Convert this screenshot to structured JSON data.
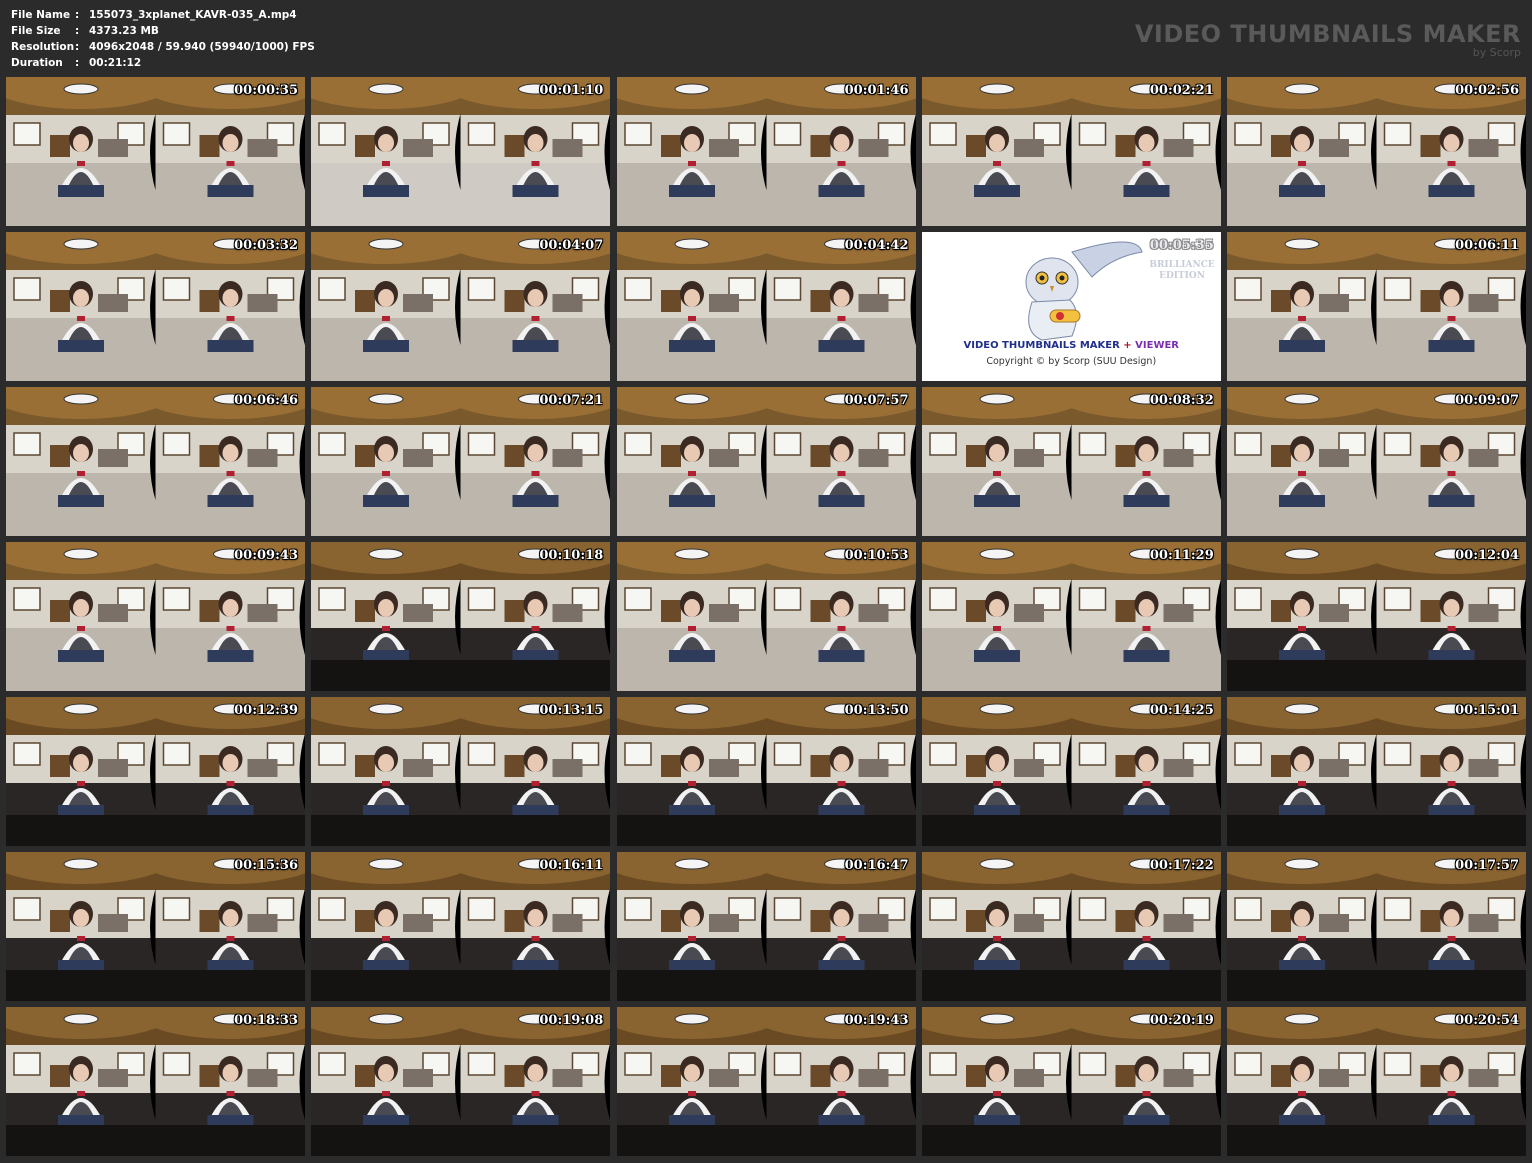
{
  "info": {
    "rows": [
      {
        "key": "File Name",
        "sep": ":",
        "value": "155073_3xplanet_KAVR-035_A.mp4"
      },
      {
        "key": "File Size",
        "sep": ":",
        "value": "4373.23 MB"
      },
      {
        "key": "Resolution",
        "sep": ":",
        "value": "4096x2048 / 59.940 (59940/1000) FPS"
      },
      {
        "key": "Duration",
        "sep": ":",
        "value": "00:21:12"
      }
    ]
  },
  "brand": {
    "title": "VIDEO THUMBNAILS MAKER",
    "subtitle": "by Scorp"
  },
  "logo_tile": {
    "line1_part1": "VIDEO THUMBNAILS MAKER",
    "line1_plus": " + ",
    "line1_part2": "VIEWER",
    "line2": "Copyright © by Scorp (SUU Design)",
    "edition_line1": "BRILLIANCE",
    "edition_line2": "EDITION",
    "colors": {
      "red": "#b0122a",
      "blue": "#1f2f8a",
      "violet": "#7a2fb3"
    }
  },
  "thumbnails": [
    {
      "time": "00:00:35",
      "scene": "room"
    },
    {
      "time": "00:01:10",
      "scene": "floor"
    },
    {
      "time": "00:01:46",
      "scene": "room"
    },
    {
      "time": "00:02:21",
      "scene": "room"
    },
    {
      "time": "00:02:56",
      "scene": "room"
    },
    {
      "time": "00:03:32",
      "scene": "room"
    },
    {
      "time": "00:04:07",
      "scene": "room"
    },
    {
      "time": "00:04:42",
      "scene": "room"
    },
    {
      "time": "00:05:35",
      "scene": "logo"
    },
    {
      "time": "00:06:11",
      "scene": "room"
    },
    {
      "time": "00:06:46",
      "scene": "room"
    },
    {
      "time": "00:07:21",
      "scene": "room"
    },
    {
      "time": "00:07:57",
      "scene": "room"
    },
    {
      "time": "00:08:32",
      "scene": "room"
    },
    {
      "time": "00:09:07",
      "scene": "room"
    },
    {
      "time": "00:09:43",
      "scene": "room"
    },
    {
      "time": "00:10:18",
      "scene": "dark"
    },
    {
      "time": "00:10:53",
      "scene": "room"
    },
    {
      "time": "00:11:29",
      "scene": "room"
    },
    {
      "time": "00:12:04",
      "scene": "dark"
    },
    {
      "time": "00:12:39",
      "scene": "dark"
    },
    {
      "time": "00:13:15",
      "scene": "dark"
    },
    {
      "time": "00:13:50",
      "scene": "dark"
    },
    {
      "time": "00:14:25",
      "scene": "dark"
    },
    {
      "time": "00:15:01",
      "scene": "dark"
    },
    {
      "time": "00:15:36",
      "scene": "dark"
    },
    {
      "time": "00:16:11",
      "scene": "dark"
    },
    {
      "time": "00:16:47",
      "scene": "dark"
    },
    {
      "time": "00:17:22",
      "scene": "dark"
    },
    {
      "time": "00:17:57",
      "scene": "dark"
    },
    {
      "time": "00:18:33",
      "scene": "dark"
    },
    {
      "time": "00:19:08",
      "scene": "dark"
    },
    {
      "time": "00:19:43",
      "scene": "dark"
    },
    {
      "time": "00:20:19",
      "scene": "dark"
    },
    {
      "time": "00:20:54",
      "scene": "dark"
    }
  ]
}
